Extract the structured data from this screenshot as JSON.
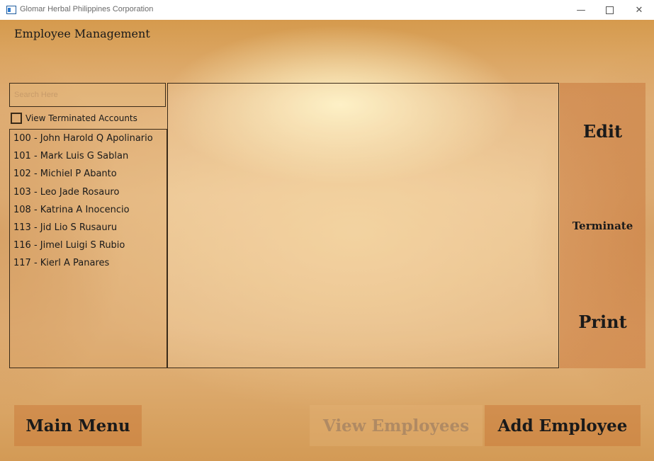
{
  "window": {
    "title": "Glomar Herbal Philippines Corporation",
    "minimize_glyph": "—",
    "close_glyph": "✕"
  },
  "page": {
    "title": "Employee Management"
  },
  "search": {
    "placeholder": "Search Here",
    "value": ""
  },
  "filter": {
    "view_terminated_label": "View Terminated Accounts",
    "checked": false
  },
  "employees": [
    "100 - John Harold Q Apolinario",
    "101 - Mark Luis G Sablan",
    "102 - Michiel P Abanto",
    "103 - Leo Jade  Rosauro",
    "108 - Katrina A Inocencio",
    "113 - Jid Lio S Rusauru",
    "116 - Jimel Luigi S Rubio",
    "117 - Kierl A Panares"
  ],
  "actions": {
    "edit": "Edit",
    "terminate": "Terminate",
    "print": "Print"
  },
  "bottom": {
    "main_menu": "Main Menu",
    "view_employees": "View Employees",
    "add_employee": "Add Employee"
  }
}
